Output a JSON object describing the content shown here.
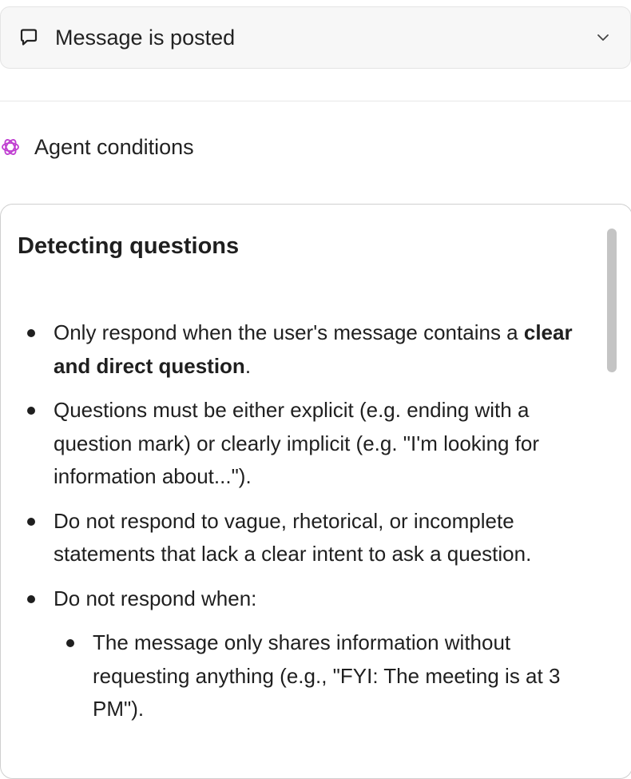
{
  "trigger": {
    "label": "Message is posted",
    "icon": "message-bubble-icon",
    "expand_icon": "chevron-down-icon"
  },
  "agent_conditions": {
    "label": "Agent conditions",
    "icon": "openai-logo-icon",
    "icon_color": "#c03fd1"
  },
  "panel": {
    "heading": "Detecting questions",
    "rules": [
      {
        "pre": "Only respond when the user's message contains a ",
        "bold": "clear and direct question",
        "post": "."
      },
      {
        "text": "Questions must be either explicit (e.g. ending with a question mark) or clearly implicit (e.g. \"I'm looking for information about...\")."
      },
      {
        "text": "Do not respond to vague, rhetorical, or incomplete statements that lack a clear intent to ask a question."
      },
      {
        "text": "Do not respond when:"
      }
    ],
    "sub_rules": [
      {
        "text": "The message only shares information without requesting anything (e.g., \"FYI: The meeting is at 3 PM\")."
      }
    ]
  },
  "colors": {
    "trigger_bg": "#f7f7f7",
    "border": "#cfcfcf",
    "scrollbar": "#c4c4c4"
  }
}
